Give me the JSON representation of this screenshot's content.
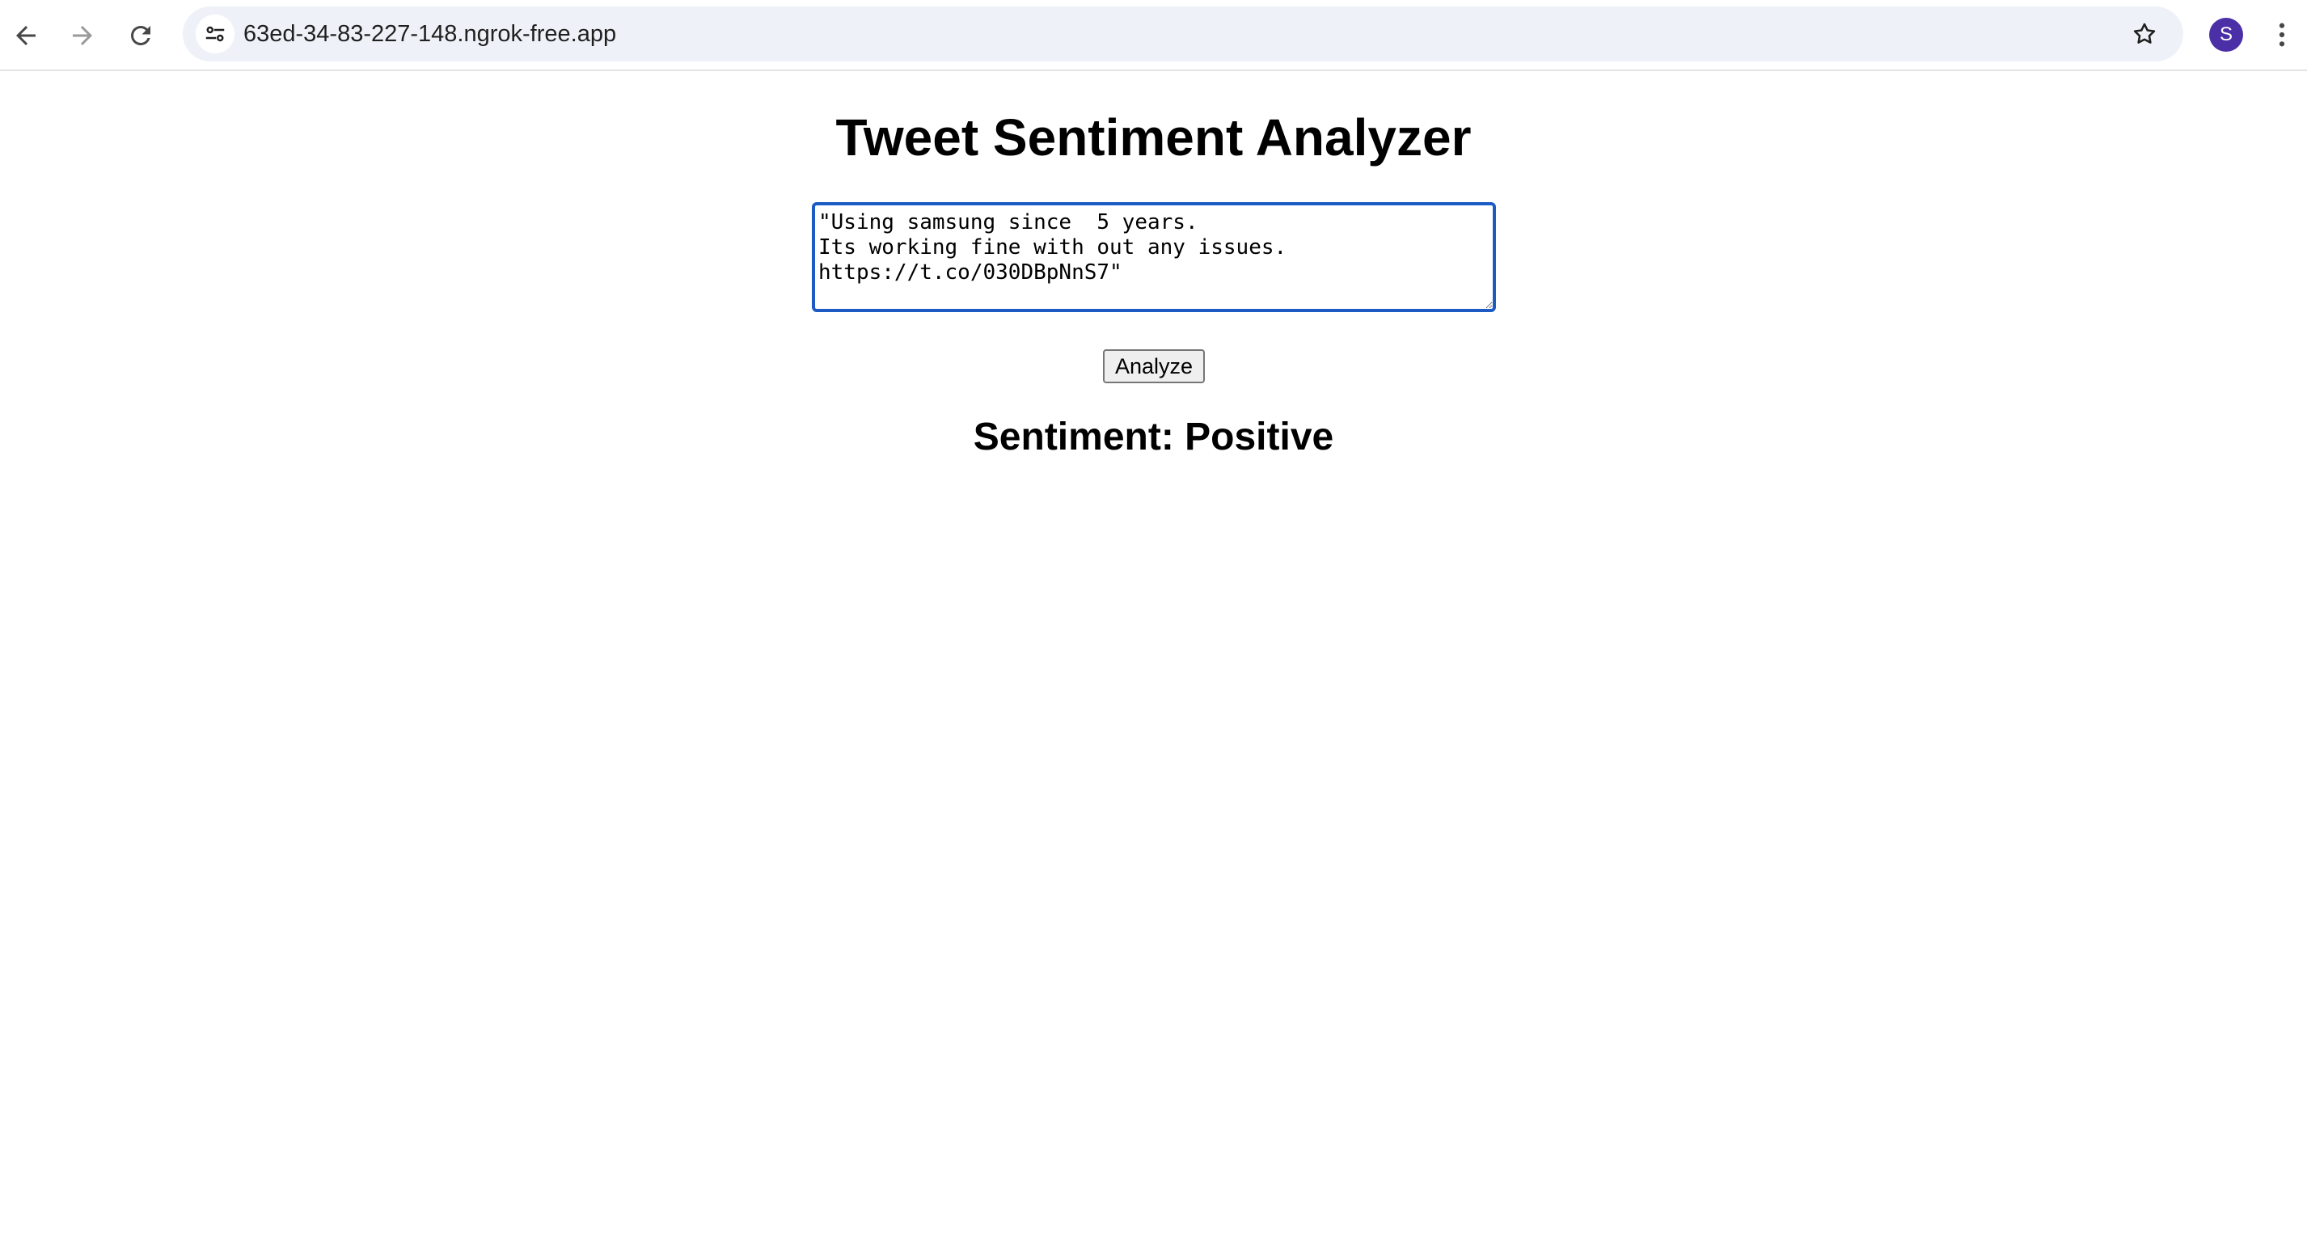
{
  "browser": {
    "url": "63ed-34-83-227-148.ngrok-free.app",
    "profile_initial": "S",
    "profile_color": "#4b2fa6",
    "icons": {
      "back": "back-arrow-icon",
      "forward": "forward-arrow-icon",
      "reload": "reload-icon",
      "site_info": "site-settings-icon",
      "bookmark": "star-icon",
      "menu": "kebab-menu-icon"
    }
  },
  "page": {
    "title": "Tweet Sentiment Analyzer",
    "tweet_text": "\"Using samsung since  5 years.\nIts working fine with out any issues.\nhttps://t.co/030DBpNnS7\"",
    "analyze_label": "Analyze",
    "result": "Sentiment: Positive"
  }
}
